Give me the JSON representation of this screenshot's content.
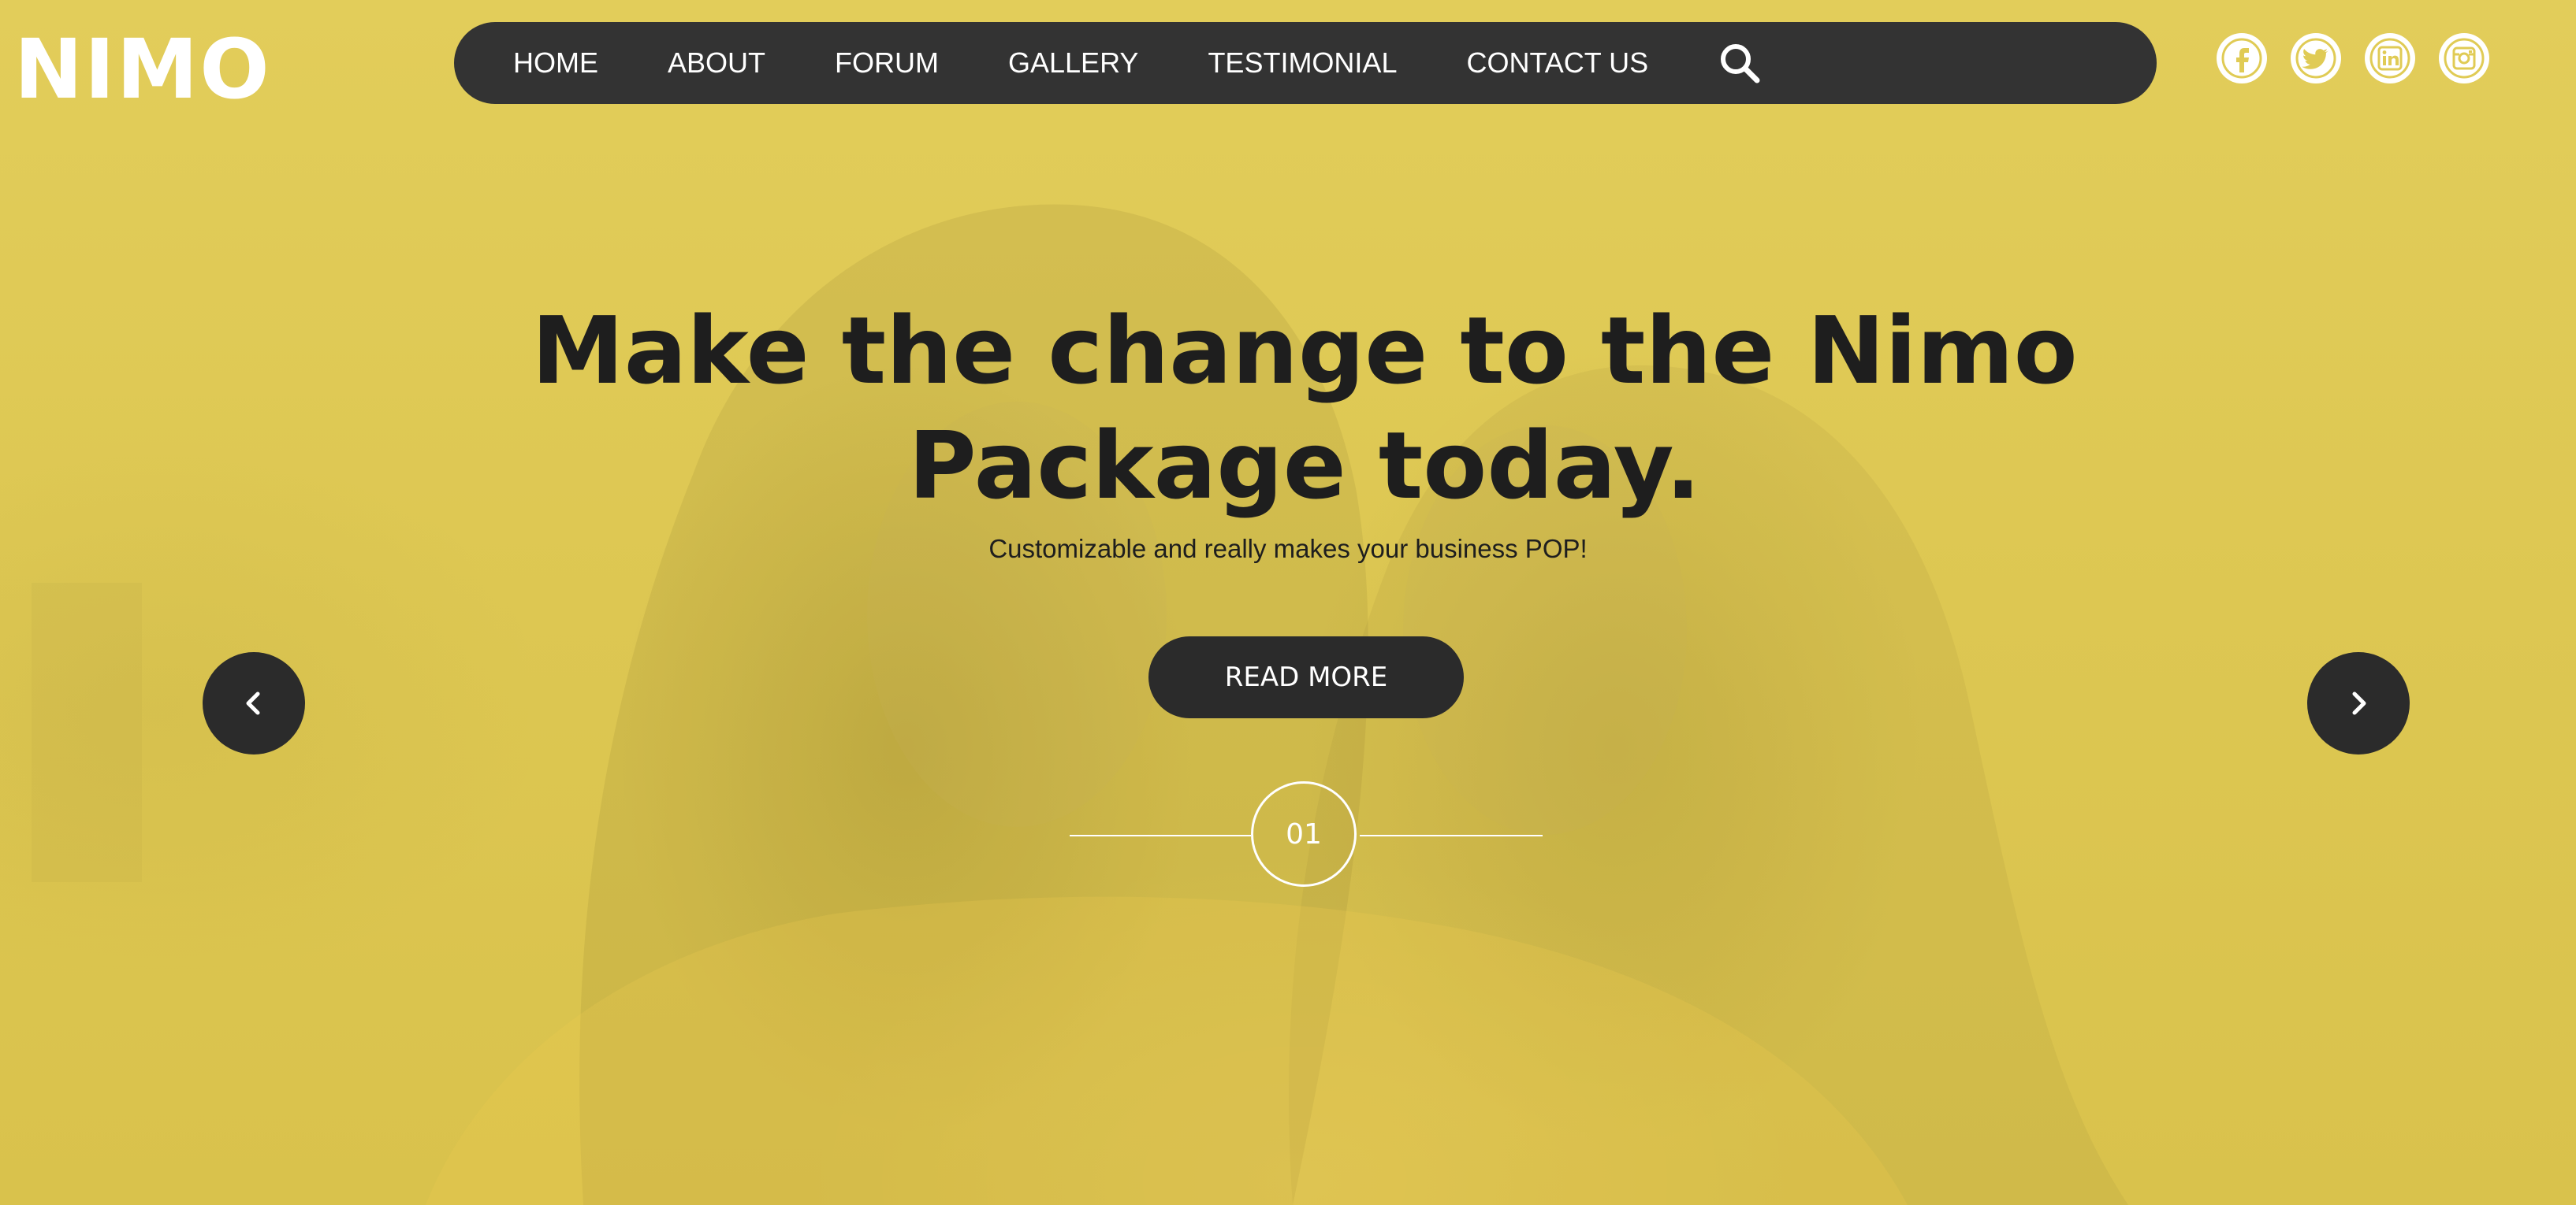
{
  "brand": {
    "logo_text": "NIMO"
  },
  "nav": {
    "items": [
      {
        "label": "HOME"
      },
      {
        "label": "ABOUT"
      },
      {
        "label": "FORUM"
      },
      {
        "label": "GALLERY"
      },
      {
        "label": "TESTIMONIAL"
      },
      {
        "label": "CONTACT US"
      }
    ],
    "search_icon": "search-icon"
  },
  "social": {
    "icons": [
      "facebook-icon",
      "twitter-icon",
      "linkedin-icon",
      "instagram-icon"
    ]
  },
  "hero": {
    "title": "Make the change to the Nimo Package today.",
    "subtitle": "Customizable and really makes your business POP!",
    "button_label": "READ MORE",
    "slide_number": "01",
    "prev_icon": "chevron-left-icon",
    "next_icon": "chevron-right-icon"
  },
  "colors": {
    "background": "#e0cb55",
    "nav_background": "#333333",
    "button_background": "#2b2b2b",
    "text_dark": "#1e1e1e",
    "text_light": "#ffffff"
  }
}
